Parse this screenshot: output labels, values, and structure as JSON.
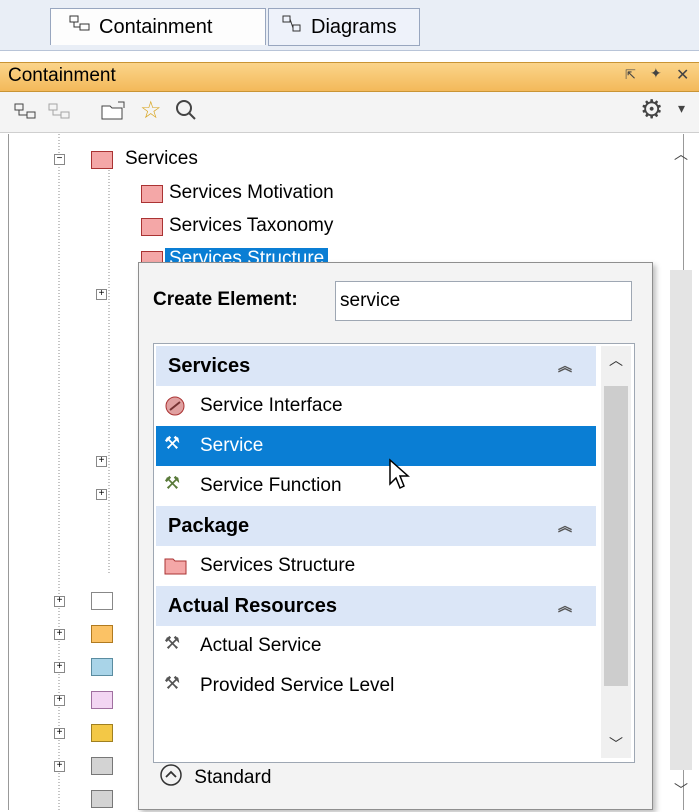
{
  "tabs": [
    {
      "label": "Containment",
      "icon": "containment-tree-icon"
    },
    {
      "label": "Diagrams",
      "icon": "diagrams-icon"
    }
  ],
  "panel": {
    "title": "Containment"
  },
  "toolbar": {
    "icons": [
      "collapse-all-icon",
      "expand-all-icon",
      "open-folder-icon",
      "favorite-star-icon",
      "search-icon",
      "gear-icon",
      "dropdown-arrow-icon"
    ]
  },
  "tree": {
    "items": [
      {
        "label": "Services"
      },
      {
        "label": "Services Motivation"
      },
      {
        "label": "Services Taxonomy"
      },
      {
        "label": "Services Structure"
      }
    ]
  },
  "popup": {
    "create_label": "Create Element:",
    "create_value": "service",
    "groups": [
      {
        "title": "Services",
        "items": [
          {
            "label": "Service Interface",
            "icon": "service-interface-icon"
          },
          {
            "label": "Service",
            "icon": "service-tools-icon",
            "selected": true
          },
          {
            "label": "Service Function",
            "icon": "service-function-icon"
          }
        ]
      },
      {
        "title": "Package",
        "items": [
          {
            "label": "Services Structure",
            "icon": "package-folder-icon"
          }
        ]
      },
      {
        "title": "Actual Resources",
        "items": [
          {
            "label": "Actual Service",
            "icon": "actual-service-icon"
          },
          {
            "label": "Provided Service Level",
            "icon": "provided-service-level-icon"
          }
        ]
      }
    ],
    "standard_label": "Standard"
  },
  "colors": {
    "selection": "#0a7ed4",
    "header": "#f3b95a",
    "group_header": "#dbe6f7"
  }
}
